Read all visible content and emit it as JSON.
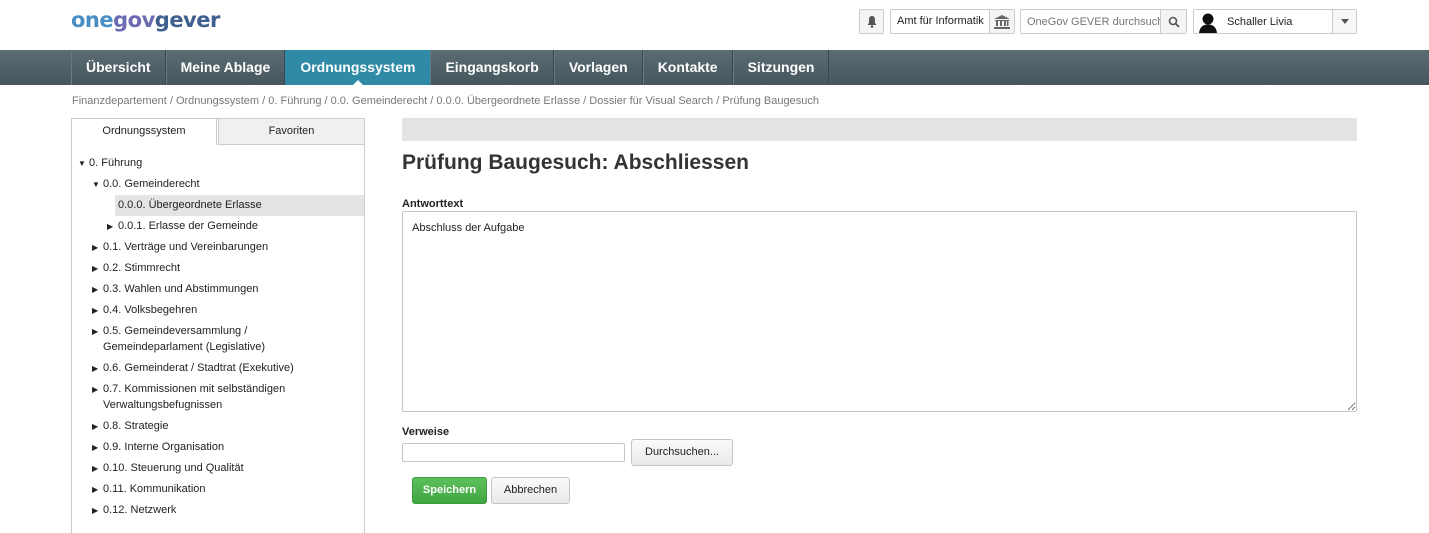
{
  "header": {
    "logo": {
      "part1": "one",
      "part2": "gov",
      "part3": "gever"
    },
    "org_unit": "Amt für Informatik",
    "search_placeholder": "OneGov GEVER durchsuchen",
    "user_name": "Schaller Livia"
  },
  "nav": {
    "items": [
      "Übersicht",
      "Meine Ablage",
      "Ordnungssystem",
      "Eingangskorb",
      "Vorlagen",
      "Kontakte",
      "Sitzungen"
    ],
    "active": "Ordnungssystem"
  },
  "breadcrumb": "Finanzdepartement / Ordnungssystem / 0. Führung / 0.0. Gemeinderecht / 0.0.0. Übergeordnete Erlasse / Dossier für Visual Search / Prüfung Baugesuch",
  "sidebar": {
    "tabs": [
      "Ordnungssystem",
      "Favoriten"
    ],
    "tree": [
      {
        "label": "0. Führung",
        "expanded": true
      },
      {
        "label": "0.0. Gemeinderecht",
        "expanded": true
      },
      {
        "label": "0.0.0. Übergeordnete Erlasse",
        "selected": true
      },
      {
        "label": "0.0.1. Erlasse der Gemeinde"
      },
      {
        "label": "0.1. Verträge und Vereinbarungen"
      },
      {
        "label": "0.2. Stimmrecht"
      },
      {
        "label": "0.3. Wahlen und Abstimmungen"
      },
      {
        "label": "0.4. Volksbegehren"
      },
      {
        "label": "0.5. Gemeindeversammlung / Gemeindeparlament (Legislative)"
      },
      {
        "label": "0.6. Gemeinderat / Stadtrat (Exekutive)"
      },
      {
        "label": "0.7. Kommissionen mit selbständigen Verwaltungsbefugnissen"
      },
      {
        "label": "0.8. Strategie"
      },
      {
        "label": "0.9. Interne Organisation"
      },
      {
        "label": "0.10. Steuerung und Qualität"
      },
      {
        "label": "0.11. Kommunikation"
      },
      {
        "label": "0.12. Netzwerk"
      }
    ]
  },
  "main": {
    "title": "Prüfung Baugesuch: Abschliessen",
    "answer_label": "Antworttext",
    "answer_value": "Abschluss der Aufgabe",
    "refs_label": "Verweise",
    "browse_label": "Durchsuchen...",
    "save_label": "Speichern",
    "cancel_label": "Abbrechen"
  },
  "colors": {
    "nav_active": "#2f8aa7",
    "nav_bg": "#4e5f66",
    "save_button": "#4cb04c"
  }
}
